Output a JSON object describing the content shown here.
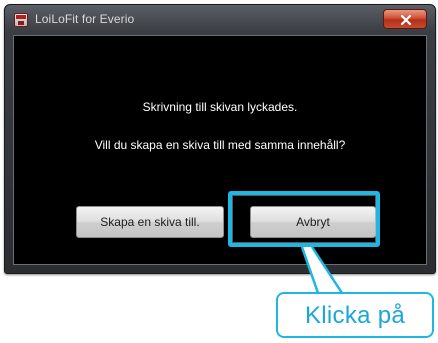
{
  "window": {
    "title": "LoiLoFit for Everio",
    "close_symbol": "×"
  },
  "dialog": {
    "message_line1": "Skrivning till skivan lyckades.",
    "message_line2": "Vill du skapa en skiva till med samma innehåll?",
    "buttons": {
      "create_another": "Skapa en skiva till.",
      "cancel": "Avbryt"
    }
  },
  "annotation": {
    "callout_text": "Klicka på",
    "accent_color": "#1eb6e3"
  },
  "colors": {
    "dialog_background": "#000000",
    "close_button": "#c64a2e"
  }
}
